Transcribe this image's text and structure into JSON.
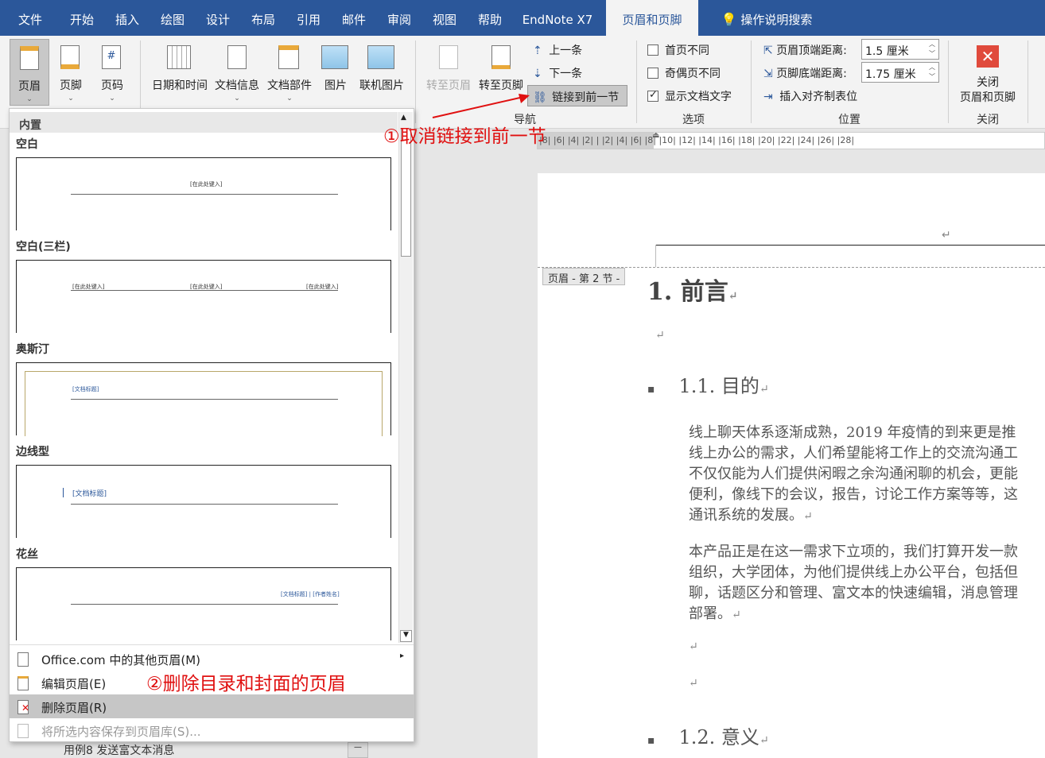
{
  "tabs": [
    "文件",
    "开始",
    "插入",
    "绘图",
    "设计",
    "布局",
    "引用",
    "邮件",
    "审阅",
    "视图",
    "帮助",
    "EndNote X7",
    "页眉和页脚"
  ],
  "search_label": "操作说明搜索",
  "ribbon": {
    "header_button": "页眉",
    "footer_button": "页脚",
    "page_number_button": "页码",
    "insert_buttons": [
      "日期和时间",
      "文档信息",
      "文档部件",
      "图片",
      "联机图片"
    ],
    "goto_header": "转至页眉",
    "goto_footer": "转至页脚",
    "prev": "上一条",
    "next": "下一条",
    "link_prev": "链接到前一节",
    "nav_group": "导航",
    "options": {
      "diff_first": "首页不同",
      "diff_odd_even": "奇偶页不同",
      "show_doc_text": "显示文档文字",
      "group": "选项"
    },
    "position": {
      "header_top_label": "页眉顶端距离:",
      "header_top_value": "1.5 厘米",
      "footer_bottom_label": "页脚底端距离:",
      "footer_bottom_value": "1.75 厘米",
      "align_tab": "插入对齐制表位",
      "group": "位置"
    },
    "close": {
      "label": "关闭\n页眉和页脚",
      "line1": "关闭",
      "line2": "页眉和页脚",
      "group": "关闭"
    }
  },
  "gallery": {
    "section": "内置",
    "items": [
      {
        "title": "空白",
        "ph": "[在此处键入]"
      },
      {
        "title": "空白(三栏)",
        "ph": "[在此处键入]"
      },
      {
        "title": "奥斯汀",
        "ph": "[文档标题]"
      },
      {
        "title": "边线型",
        "ph": "[文档标题]"
      },
      {
        "title": "花丝",
        "ph": "[文档标题] | [作者姓名]"
      }
    ],
    "menu": [
      "Office.com 中的其他页眉(M)",
      "编辑页眉(E)",
      "删除页眉(R)",
      "将所选内容保存到页眉库(S)..."
    ],
    "behind_text": "用例8 发送富文本消息"
  },
  "annotations": {
    "a1": "①取消链接到前一节",
    "a2": "②删除目录和封面的页眉"
  },
  "ruler_text": "|8|  |6|  |4|  |2|     |   |2|  |4|  |6|  |8|  |10|  |12|  |14|  |16|  |18|  |20|  |22|  |24|  |26|  |28|",
  "document": {
    "header_tag": "页眉 - 第 2 节 -",
    "h1": "1. 前言",
    "h2a": "1.1.   目的",
    "p1": [
      "线上聊天体系逐渐成熟，2019 年疫情的到来更是推",
      "线上办公的需求，人们希望能将工作上的交流沟通工",
      "不仅仅能为人们提供闲暇之余沟通闲聊的机会，更能",
      "便利，像线下的会议，报告，讨论工作方案等等，这",
      "通讯系统的发展。"
    ],
    "p2": [
      "本产品正是在这一需求下立项的，我们打算开发一款",
      "组织，大学团体，为他们提供线上办公平台，包括但",
      "聊，话题区分和管理、富文本的快速编辑，消息管理",
      "部署。"
    ],
    "h2b": "1.2.   意义",
    "return_mark": "↵"
  }
}
